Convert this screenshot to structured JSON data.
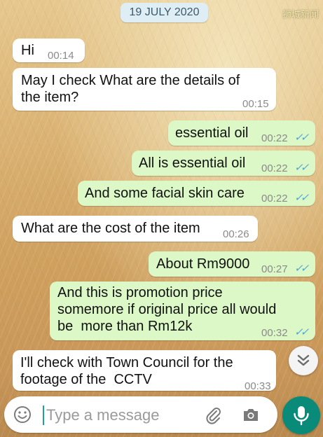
{
  "date_label": "19 JULY 2020",
  "watermark": "狮城新闻",
  "messages": [
    {
      "dir": "in",
      "text": "Hi",
      "time": "00:14"
    },
    {
      "dir": "in",
      "text": "May I check What are the details of\nthe item?",
      "time": "00:15"
    },
    {
      "dir": "out",
      "text": "essential oil",
      "time": "00:22",
      "ticks": "✓✓"
    },
    {
      "dir": "out",
      "text": "All is essential oil",
      "time": "00:22",
      "ticks": "✓✓"
    },
    {
      "dir": "out",
      "text": "And some facial skin care",
      "time": "00:22",
      "ticks": "✓✓"
    },
    {
      "dir": "in",
      "text": "What are the cost of the item",
      "time": "00:26"
    },
    {
      "dir": "out",
      "text": "About Rm9000",
      "time": "00:27",
      "ticks": "✓✓"
    },
    {
      "dir": "out",
      "text": "And this is promotion price\nsomemore if original price all would\nbe  more than Rm12k",
      "time": "00:32",
      "ticks": "✓✓"
    },
    {
      "dir": "in",
      "text": "I'll check with Town Council for the\nfootage of the  CCTV",
      "time": "00:33"
    }
  ],
  "composer": {
    "placeholder": "Type a message",
    "emoji_icon": "emoji-icon",
    "attach_icon": "paperclip-icon",
    "camera_icon": "camera-icon",
    "mic_icon": "microphone-icon"
  },
  "scroll_icon": "double-chevron-down-icon",
  "colors": {
    "incoming_bubble": "#ffffff",
    "outgoing_bubble": "#dcf8c6",
    "read_ticks": "#4fa3d8",
    "send_button": "#0a8a78",
    "date_pill": "#dfeef5"
  }
}
